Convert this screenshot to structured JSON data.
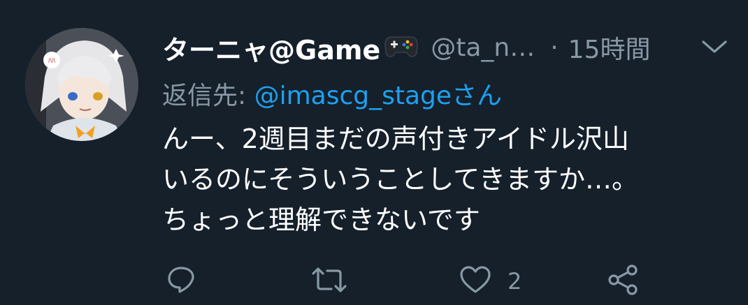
{
  "tweet": {
    "display_name": "ターニャ@Game",
    "handle": "@ta_n…",
    "separator": "·",
    "time": "15時間",
    "reply_prefix": "返信先: ",
    "reply_to": "@imascg_stageさん",
    "body_lines": [
      "んー、2週目まだの声付きアイドル沢山",
      "いるのにそういうことしてきますか…。",
      "ちょっと理解できないです"
    ],
    "like_count": "2"
  },
  "icons": {
    "name_badge": "gamepad-icon",
    "menu": "chevron-down-icon",
    "reply": "reply-icon",
    "retweet": "retweet-icon",
    "like": "heart-icon",
    "share": "share-icon"
  },
  "colors": {
    "background": "#15202b",
    "secondary_text": "#8899a6",
    "link": "#1da1f2"
  }
}
